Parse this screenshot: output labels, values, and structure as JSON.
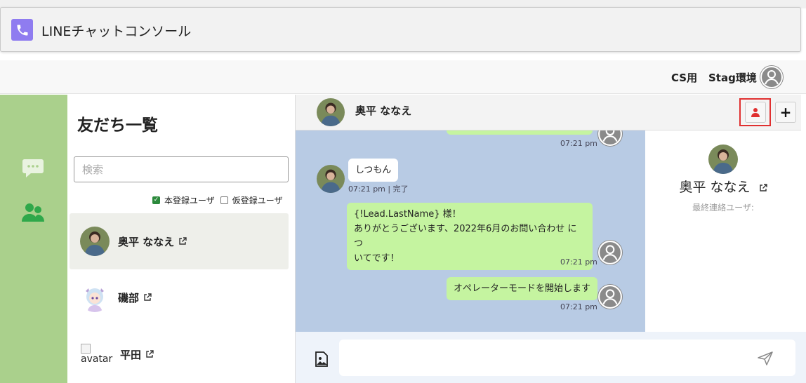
{
  "app": {
    "title": "LINEチャットコンソール",
    "logo_icon": "phone-icon",
    "logo_color": "#8f7cf0"
  },
  "header": {
    "cs_label": "CS用",
    "env_label": "Stag環境"
  },
  "rail": {
    "items": [
      {
        "icon": "chat-bubble-icon"
      },
      {
        "icon": "friends-icon"
      }
    ],
    "bg_color": "#aad08c"
  },
  "friends": {
    "title": "友だち一覧",
    "search_placeholder": "検索",
    "filters": [
      {
        "label": "本登録ユーザ",
        "checked": true
      },
      {
        "label": "仮登録ユーザ",
        "checked": false
      }
    ],
    "items": [
      {
        "name": "奥平 ななえ",
        "selected": true
      },
      {
        "name": "磯部",
        "selected": false
      },
      {
        "name": "平田",
        "selected": false,
        "avatar_alt": "avatar"
      }
    ]
  },
  "chat": {
    "contact_name": "奥平 ななえ",
    "messages": [
      {
        "side": "right",
        "text": "",
        "time": "07:21 pm"
      },
      {
        "side": "left",
        "text": "しつもん",
        "time": "07:21 pm | 完了"
      },
      {
        "side": "right",
        "lines": [
          "{!Lead.LastName} 様！",
          "ありがとうございます、2022年6月のお問い合わせ につ",
          "いてです！"
        ],
        "time": "07:21 pm"
      },
      {
        "side": "right",
        "text": "オペレーターモードを開始します",
        "time": "07:21 pm"
      }
    ],
    "bg_color": "#b8cbe4",
    "bubble_color": "#c5f4a0"
  },
  "profile": {
    "name": "奥平 ななえ",
    "last_contact_label": "最終連絡ユーザ:"
  },
  "input": {
    "placeholder": ""
  }
}
